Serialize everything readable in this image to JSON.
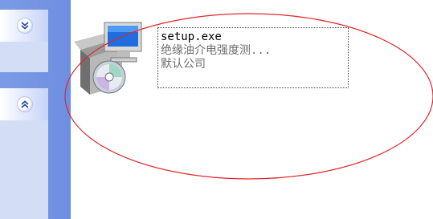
{
  "file": {
    "name": "setup.exe",
    "description": "绝缘油介电强度测...",
    "company": "默认公司"
  },
  "task_pane": {
    "groups": [
      {
        "toggle": "expand-chevron-icon"
      },
      {
        "toggle": "collapse-chevron-icon"
      }
    ]
  },
  "colors": {
    "pane_blue": "#7b9ae6",
    "annotation_red": "#e0262a"
  }
}
